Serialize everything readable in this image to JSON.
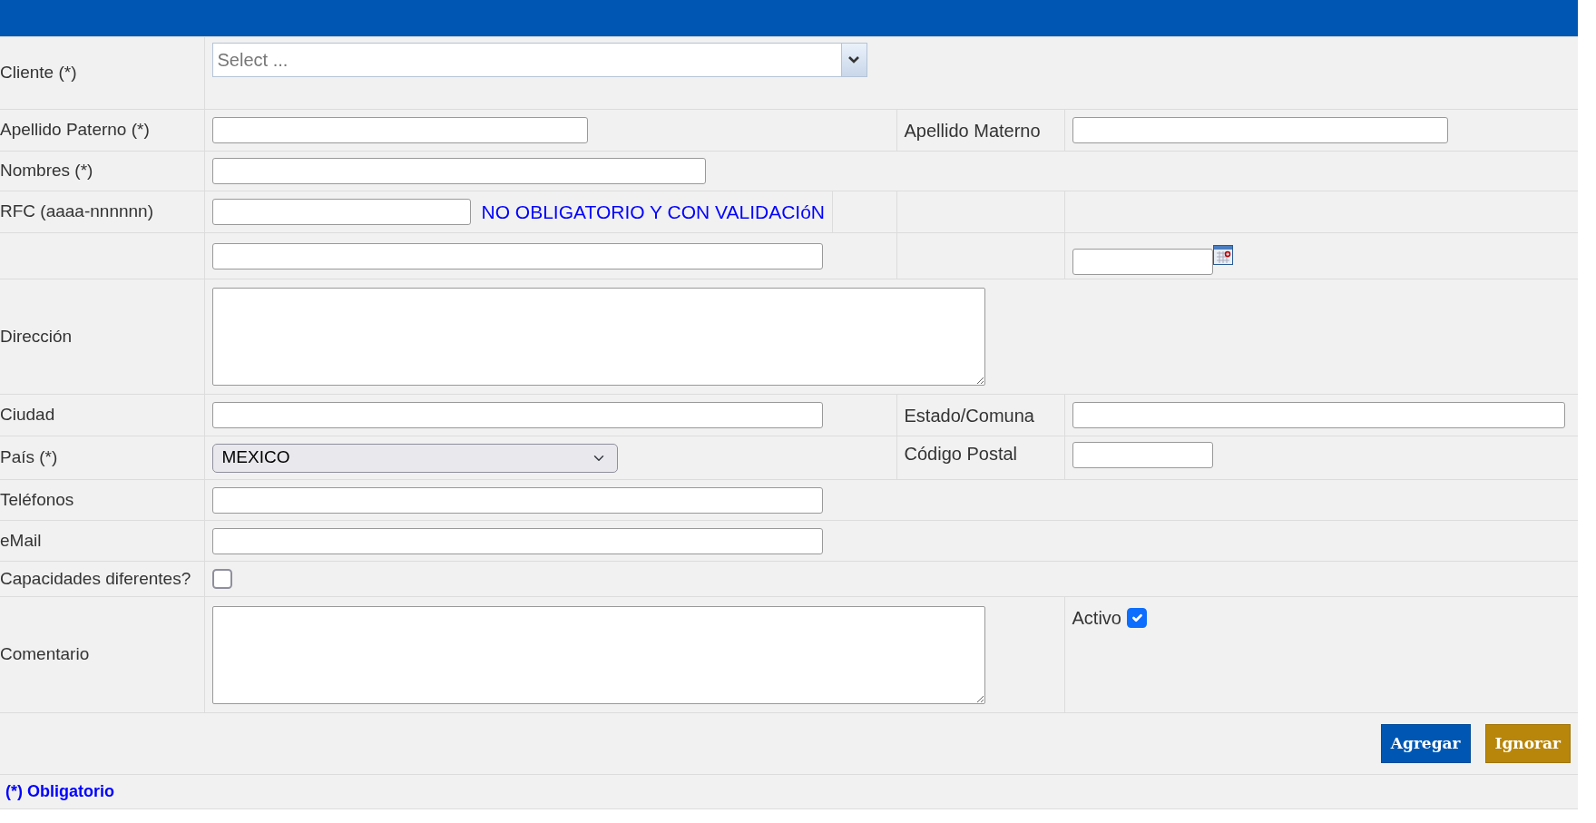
{
  "rows": [
    {
      "label": "Cliente (*)",
      "field": {
        "kind": "combo",
        "placeholder": "Select ..."
      }
    },
    {
      "label": "Apellido Paterno (*)",
      "field": {
        "kind": "text"
      },
      "side": {
        "label": "Apellido Materno",
        "field": {
          "kind": "text"
        }
      }
    },
    {
      "label": "Nombres (*)",
      "field": {
        "kind": "text"
      }
    },
    {
      "label": "RFC (aaaa-nnnnnn)",
      "field": {
        "kind": "text",
        "note": "NO OBLIGATORIO Y CON VALIDACIóN"
      },
      "side": {
        "field": {
          "kind": "none"
        }
      }
    },
    {
      "field": {
        "kind": "text"
      },
      "side": {
        "field": {
          "kind": "date"
        }
      }
    },
    {
      "label": "Dirección",
      "field": {
        "kind": "textarea"
      }
    },
    {
      "label": "Ciudad",
      "field": {
        "kind": "text"
      },
      "side": {
        "label": "Estado/Comuna",
        "field": {
          "kind": "text"
        }
      }
    },
    {
      "label": "País (*)",
      "field": {
        "kind": "select",
        "value": "MEXICO"
      },
      "side": {
        "label": "Código Postal",
        "field": {
          "kind": "text"
        }
      }
    },
    {
      "label": "Teléfonos",
      "field": {
        "kind": "text"
      }
    },
    {
      "label": "eMail",
      "field": {
        "kind": "text"
      }
    },
    {
      "label": "Capacidades diferentes?",
      "field": {
        "kind": "checkbox",
        "checked": false
      }
    },
    {
      "label": "Comentario",
      "field": {
        "kind": "textarea"
      },
      "side": {
        "field": {
          "kind": "checkbox",
          "label": "Activo",
          "checked": true
        }
      }
    }
  ],
  "buttons": [
    {
      "label": "Agregar",
      "kind": "primary"
    },
    {
      "label": "Ignorar",
      "kind": "secondary"
    }
  ],
  "footnote": "(*) Obligatorio"
}
